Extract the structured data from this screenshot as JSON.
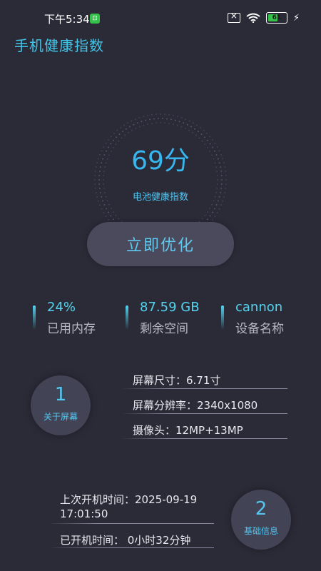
{
  "status_bar": {
    "time": "下午5:34",
    "app_badge": "⊡",
    "battery_level": "61",
    "battery_fraction": 0.61
  },
  "header": {
    "title": "手机健康指数"
  },
  "gauge": {
    "score": "69分",
    "label": "电池健康指数"
  },
  "optimize_button": {
    "label": "立即优化"
  },
  "stats": [
    {
      "value": "24%",
      "label": "已用内存"
    },
    {
      "value": "87.59 GB",
      "label": "剩余空间"
    },
    {
      "value": "cannon",
      "label": "设备名称"
    }
  ],
  "screen_section": {
    "number": "1",
    "title": "关于屏幕",
    "rows": [
      "屏幕尺寸：6.71寸",
      "屏幕分辨率：2340x1080",
      "摄像头：12MP+13MP"
    ]
  },
  "basic_section": {
    "number": "2",
    "title": "基础信息",
    "boot_time_label": "上次开机时间：",
    "boot_time_date": "2025-09-19",
    "boot_time_clock": "17:01:50",
    "uptime": "已开机时间：  0小时32分钟"
  },
  "colors": {
    "background": "#2b2b38",
    "accent": "#41c6e9",
    "button": "#4a4a5c",
    "circle": "#434356"
  }
}
